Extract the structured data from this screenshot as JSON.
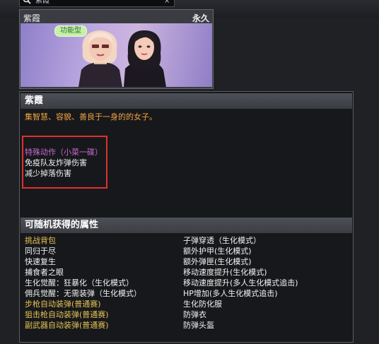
{
  "search": {
    "text": "紫霞",
    "clear_label": "×"
  },
  "card": {
    "name": "紫霞",
    "duration": "永久",
    "type_tag": "功能型"
  },
  "detail": {
    "title": "紫霞",
    "description": "集智慧、容貌、善良于一身的的女子。",
    "skill_action": "特殊动作（小菜一碟）",
    "skill_effects": [
      "免疫队友炸弹伤害",
      "减少掉落伤害"
    ]
  },
  "attributes": {
    "title": "可随机获得的属性",
    "left": [
      {
        "text": "挑战背包",
        "color": "yellow"
      },
      {
        "text": "同归于尽",
        "color": "white"
      },
      {
        "text": "快速复生",
        "color": "white"
      },
      {
        "text": "捕食者之眼",
        "color": "white"
      },
      {
        "text": "生化觉醒：狂暴化（生化模式）",
        "color": "white"
      },
      {
        "text": "佣兵觉醒：无需装弹（生化模式）",
        "color": "white"
      },
      {
        "text": "步枪自动装弹(普通赛)",
        "color": "yellow"
      },
      {
        "text": "狙击枪自动装弹(普通赛)",
        "color": "yellow"
      },
      {
        "text": "副武器自动装弹(普通赛)",
        "color": "yellow"
      }
    ],
    "right": [
      {
        "text": "子弹穿透（生化模式）",
        "color": "white"
      },
      {
        "text": "额外护甲(生化模式)",
        "color": "white"
      },
      {
        "text": "额外弹匣(生化模式)",
        "color": "white"
      },
      {
        "text": "移动速度提升(生化模式)",
        "color": "white"
      },
      {
        "text": "移动速度提升(多人生化模式追击)",
        "color": "white"
      },
      {
        "text": "HP增加(多人生化模式追击)",
        "color": "white"
      },
      {
        "text": "生化防化服",
        "color": "white"
      },
      {
        "text": "防弹衣",
        "color": "white"
      },
      {
        "text": "防弹头盔",
        "color": "white"
      }
    ]
  },
  "colors": {
    "yellow": "#e6c355",
    "white": "#f2f2f2",
    "pink": "#c768d2",
    "orange": "#f0a343",
    "highlight": "#e03030"
  },
  "icons": [
    "search-icon",
    "close-icon",
    "settings-icon"
  ]
}
